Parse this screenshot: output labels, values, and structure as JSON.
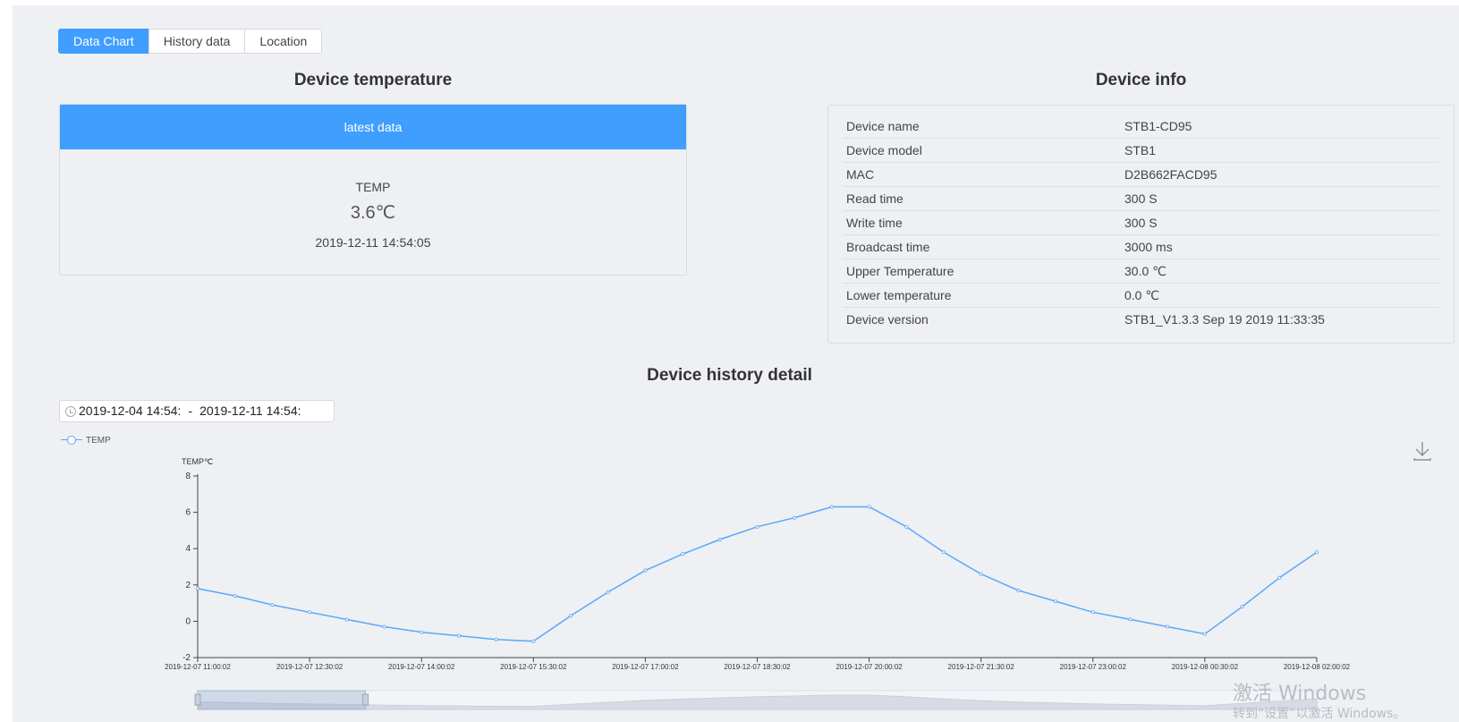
{
  "tabs": [
    {
      "label": "Data Chart",
      "active": true
    },
    {
      "label": "History data",
      "active": false
    },
    {
      "label": "Location",
      "active": false
    }
  ],
  "temperature": {
    "title": "Device temperature",
    "header": "latest data",
    "label": "TEMP",
    "value": "3.6℃",
    "time": "2019-12-11 14:54:05"
  },
  "device_info": {
    "title": "Device info",
    "rows": [
      {
        "key": "Device name",
        "value": "STB1-CD95"
      },
      {
        "key": "Device model",
        "value": "STB1"
      },
      {
        "key": "MAC",
        "value": "D2B662FACD95"
      },
      {
        "key": "Read time",
        "value": "300 S"
      },
      {
        "key": "Write time",
        "value": "300 S"
      },
      {
        "key": "Broadcast time",
        "value": "3000 ms"
      },
      {
        "key": "Upper Temperature",
        "value": "30.0 ℃"
      },
      {
        "key": "Lower temperature",
        "value": "0.0 ℃"
      },
      {
        "key": "Device version",
        "value": "STB1_V1.3.3 Sep 19 2019 11:33:35"
      }
    ]
  },
  "history": {
    "title": "Device history detail",
    "range_start": "2019-12-04 14:54:",
    "range_sep": "-",
    "range_end": "2019-12-11 14:54:",
    "legend_label": "TEMP",
    "download_icon": "download-icon",
    "clock_icon": "clock-icon"
  },
  "chart_data": {
    "type": "line",
    "series": [
      {
        "name": "TEMP",
        "color": "#5aa8f6"
      }
    ],
    "ylabel": "TEMP℃",
    "ylim": [
      -2,
      8
    ],
    "yticks": [
      -2,
      0,
      2,
      4,
      6,
      8
    ],
    "xlim": [
      "2019-12-07 11:00:02",
      "2019-12-08 02:00:02"
    ],
    "xticks": [
      "2019-12-07 11:00:02",
      "2019-12-07 12:30:02",
      "2019-12-07 14:00:02",
      "2019-12-07 15:30:02",
      "2019-12-07 17:00:02",
      "2019-12-07 18:30:02",
      "2019-12-07 20:00:02",
      "2019-12-07 21:30:02",
      "2019-12-07 23:00:02",
      "2019-12-08 00:30:02",
      "2019-12-08 02:00:02"
    ],
    "points": [
      [
        "2019-12-07 11:00:02",
        1.8
      ],
      [
        "2019-12-07 11:30:02",
        1.4
      ],
      [
        "2019-12-07 12:00:02",
        0.9
      ],
      [
        "2019-12-07 12:30:02",
        0.5
      ],
      [
        "2019-12-07 13:00:02",
        0.1
      ],
      [
        "2019-12-07 13:30:02",
        -0.3
      ],
      [
        "2019-12-07 14:00:02",
        -0.6
      ],
      [
        "2019-12-07 14:30:02",
        -0.8
      ],
      [
        "2019-12-07 15:00:02",
        -1.0
      ],
      [
        "2019-12-07 15:30:02",
        -1.1
      ],
      [
        "2019-12-07 16:00:02",
        0.3
      ],
      [
        "2019-12-07 16:30:02",
        1.6
      ],
      [
        "2019-12-07 17:00:02",
        2.8
      ],
      [
        "2019-12-07 17:30:02",
        3.7
      ],
      [
        "2019-12-07 18:00:02",
        4.5
      ],
      [
        "2019-12-07 18:30:02",
        5.2
      ],
      [
        "2019-12-07 19:00:02",
        5.7
      ],
      [
        "2019-12-07 19:30:02",
        6.3
      ],
      [
        "2019-12-07 20:00:02",
        6.3
      ],
      [
        "2019-12-07 20:30:02",
        5.2
      ],
      [
        "2019-12-07 21:00:02",
        3.8
      ],
      [
        "2019-12-07 21:30:02",
        2.6
      ],
      [
        "2019-12-07 22:00:02",
        1.7
      ],
      [
        "2019-12-07 22:30:02",
        1.1
      ],
      [
        "2019-12-07 23:00:02",
        0.5
      ],
      [
        "2019-12-07 23:30:02",
        0.1
      ],
      [
        "2019-12-08 00:00:02",
        -0.3
      ],
      [
        "2019-12-08 00:30:02",
        -0.7
      ],
      [
        "2019-12-08 01:00:02",
        0.8
      ],
      [
        "2019-12-08 01:30:02",
        2.4
      ],
      [
        "2019-12-08 02:00:02",
        3.8
      ]
    ],
    "grid": false,
    "legend_position": "top-left",
    "zoom_window": [
      0,
      0.15
    ]
  },
  "watermark": {
    "line1": "激活 Windows",
    "line2": "转到“设置”以激活 Windows。"
  }
}
